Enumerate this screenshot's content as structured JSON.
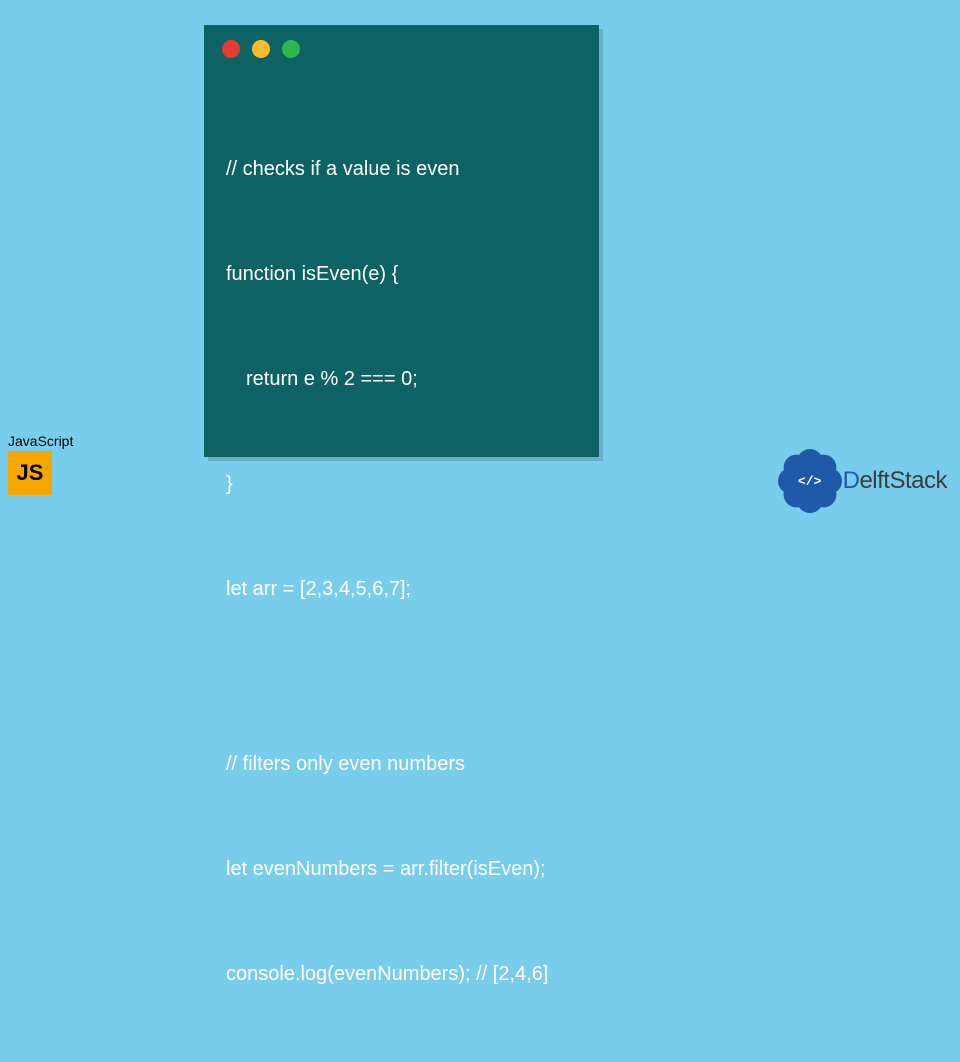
{
  "code": {
    "lines": [
      "// checks if a value is even",
      "function isEven(e) {",
      " return e % 2 === 0;",
      "}",
      "let arr = [2,3,4,5,6,7];",
      "",
      "// filters only even numbers",
      "let evenNumbers = arr.filter(isEven);",
      "console.log(evenNumbers); // [2,4,6]"
    ]
  },
  "js_badge": {
    "label": "JavaScript",
    "icon_text": "JS"
  },
  "delft": {
    "center_glyph": "</>",
    "brand_first": "D",
    "brand_rest": "elftStack"
  }
}
